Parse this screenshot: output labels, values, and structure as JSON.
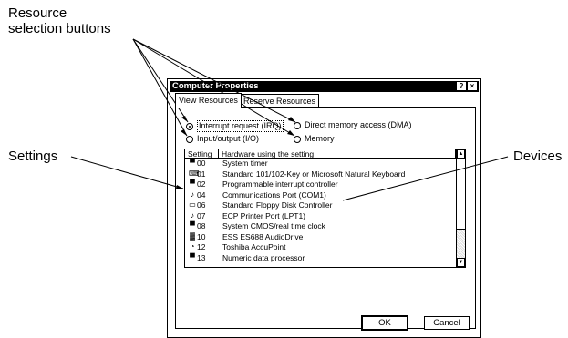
{
  "callouts": {
    "resource_buttons": [
      "Resource",
      "selection buttons"
    ],
    "settings": "Settings",
    "devices": "Devices"
  },
  "dialog": {
    "title": "Computer Properties",
    "help_glyph": "?",
    "close_glyph": "×",
    "tabs": [
      "View Resources",
      "Reserve Resources"
    ],
    "radios": {
      "irq": "Interrupt request (IRQ)",
      "dma": "Direct memory access (DMA)",
      "io": "Input/output (I/O)",
      "memory": "Memory"
    },
    "list": {
      "headers": {
        "setting": "Setting",
        "hardware": "Hardware using the setting"
      },
      "rows": [
        {
          "icon": "computer-icon",
          "setting": "00",
          "hardware": "System timer"
        },
        {
          "icon": "keyboard-icon",
          "setting": "01",
          "hardware": "Standard 101/102-Key or Microsoft Natural Keyboard"
        },
        {
          "icon": "computer-icon",
          "setting": "02",
          "hardware": "Programmable interrupt controller"
        },
        {
          "icon": "port-icon",
          "setting": "04",
          "hardware": "Communications Port (COM1)"
        },
        {
          "icon": "floppy-icon",
          "setting": "06",
          "hardware": "Standard Floppy Disk Controller"
        },
        {
          "icon": "port-icon",
          "setting": "07",
          "hardware": "ECP Printer Port (LPT1)"
        },
        {
          "icon": "computer-icon",
          "setting": "08",
          "hardware": "System CMOS/real time clock"
        },
        {
          "icon": "sound-icon",
          "setting": "10",
          "hardware": "ESS ES688 AudioDrive"
        },
        {
          "icon": "mouse-icon",
          "setting": "12",
          "hardware": "Toshiba AccuPoint"
        },
        {
          "icon": "computer-icon",
          "setting": "13",
          "hardware": "Numeric data processor"
        }
      ]
    },
    "buttons": {
      "ok": "OK",
      "cancel": "Cancel"
    }
  }
}
